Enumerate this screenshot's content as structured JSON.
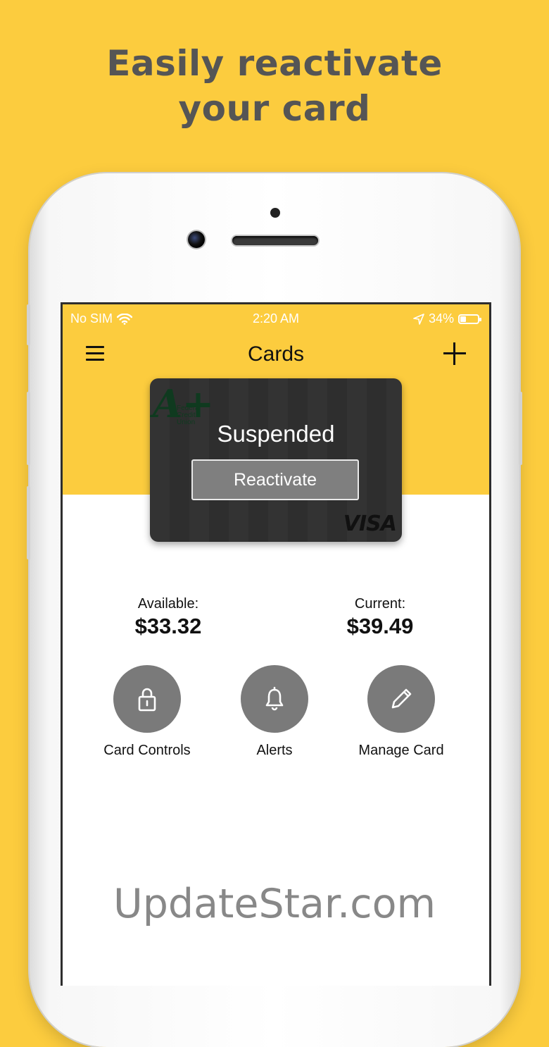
{
  "headline": {
    "line1": "Easily reactivate",
    "line2": "your card"
  },
  "statusbar": {
    "carrier": "No SIM",
    "time": "2:20 AM",
    "battery": "34%",
    "battery_level": 0.34
  },
  "navbar": {
    "title": "Cards"
  },
  "card": {
    "status": "Suspended",
    "action_label": "Reactivate",
    "issuer_logo": "A+",
    "issuer_lines": [
      "Federal",
      "Credit",
      "Union"
    ],
    "network": "VISA"
  },
  "balances": {
    "available": {
      "label": "Available:",
      "value": "$33.32"
    },
    "current": {
      "label": "Current:",
      "value": "$39.49"
    }
  },
  "actions": [
    {
      "label": "Card Controls",
      "icon": "lock-icon"
    },
    {
      "label": "Alerts",
      "icon": "bell-icon"
    },
    {
      "label": "Manage Card",
      "icon": "pencil-icon"
    }
  ],
  "watermark": "UpdateStar.com",
  "colors": {
    "background": "#fccc3e",
    "headline": "#555555",
    "card": "#2f2f2f",
    "action_circle": "#7a7a7a"
  }
}
